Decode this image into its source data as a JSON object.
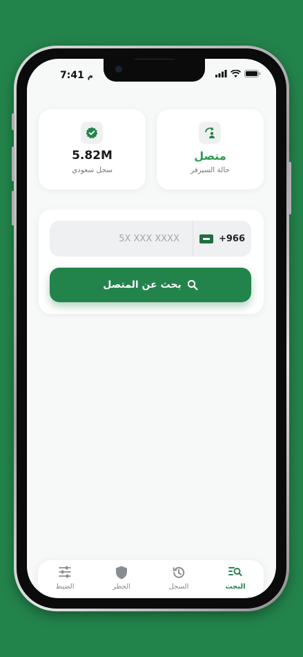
{
  "status_bar": {
    "time": "7:41",
    "time_suffix": "م"
  },
  "stats": {
    "server": {
      "value": "متصل",
      "label": "حالة السيرفر"
    },
    "records": {
      "value": "5.82M",
      "label": "سجل سعودي"
    }
  },
  "search": {
    "country_code": "+966",
    "placeholder": "5X XXX XXXX",
    "button_label": "بحث عن المتصل"
  },
  "tabs": [
    {
      "label": "البحث",
      "icon": "search-list-icon",
      "active": true
    },
    {
      "label": "السجل",
      "icon": "history-icon",
      "active": false
    },
    {
      "label": "الحظر",
      "icon": "shield-icon",
      "active": false
    },
    {
      "label": "الضبط",
      "icon": "sliders-icon",
      "active": false
    }
  ],
  "colors": {
    "brand": "#23844b",
    "status_green": "#2a9a4e"
  }
}
